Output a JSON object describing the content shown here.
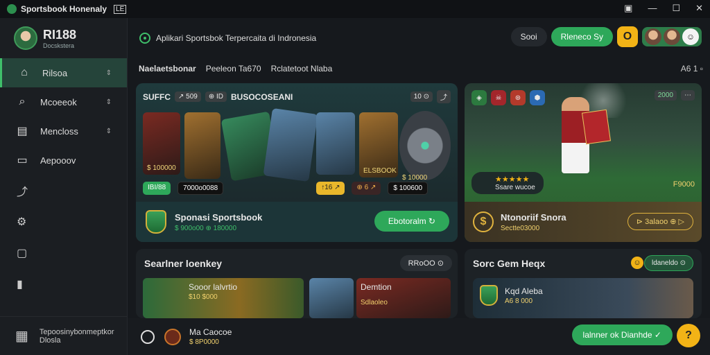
{
  "window": {
    "title": "Sportsbook Honenaly",
    "mark": "LE",
    "controls": [
      "▣",
      "—",
      "☐",
      "✕"
    ]
  },
  "brand": {
    "name": "RI188",
    "sub": "Docskstera"
  },
  "sidebar": {
    "items": [
      {
        "label": "Rilsoa",
        "icon": "home-icon",
        "glyph": "⌂",
        "chev": "⇕"
      },
      {
        "label": "Mcoeeok",
        "icon": "search-icon",
        "glyph": "⌕",
        "chev": "⇕"
      },
      {
        "label": "Mencloss",
        "icon": "calendar-icon",
        "glyph": "▤",
        "chev": "⇕"
      },
      {
        "label": "Aepooov",
        "icon": "document-icon",
        "glyph": "▭",
        "chev": ""
      }
    ],
    "icon_items": [
      {
        "icon": "share-icon",
        "glyph": "⤴"
      },
      {
        "icon": "gear-icon",
        "glyph": "⚙"
      },
      {
        "icon": "image-icon",
        "glyph": "▢"
      },
      {
        "icon": "bag-icon",
        "glyph": "▮"
      }
    ],
    "footer": {
      "line1": "Tepoosinybonmeptkor",
      "line2": "Dlosla",
      "glyph": "▦"
    }
  },
  "topbar": {
    "tagline": "Aplikari Sportsbok Terpercaita di Indronesia",
    "pill_dark": "Sooi",
    "pill_green": "Rleneco Sy",
    "coin": "O"
  },
  "tabs": {
    "items": [
      "Naelaetsbonar",
      "Peeleon Ta670",
      "Rclatetoot Nlaba"
    ],
    "right": "A6 1 ▫"
  },
  "main_card": {
    "header": "SUFFC",
    "tags": [
      "↗ 509",
      "⊕ ID"
    ],
    "heading": "BUSOCOSEANI",
    "header_right": [
      "10 ⊙",
      "⤴"
    ],
    "tile_labels": [
      "$ 100000",
      "ELSBOOK",
      "$ 10000"
    ],
    "chips": [
      "IBI/88",
      "7000o0088",
      "↑16 ↗",
      "⊕ 6 ↗",
      "$ 100600"
    ],
    "title": "Sponasi Sportsbook",
    "sub": "$ 900o00 ⊕ 180000",
    "button": "Ebotoralm ↻"
  },
  "stadium_card": {
    "badges": [
      "◈",
      "☠",
      "⊛",
      "⬢"
    ],
    "stat": [
      "2000",
      "⋯"
    ],
    "stars": "★★★★★",
    "rating_text": "Ssare wucoe",
    "price": "F9000",
    "title": "Ntonoriif Snora",
    "sub": "Sectte03000",
    "medal": "$",
    "button": "⊳ 3alaoo ⊕ ▷"
  },
  "promo_left": {
    "title": "Searlner loenkey",
    "pill": "RRoOO ⊙",
    "thumb1_title": "Sooor lalvrtio",
    "thumb1_sub": "$10 $000",
    "thumb2_title": "Demtion",
    "thumb2_sub": "Sdlaoleo"
  },
  "promo_right": {
    "title": "Sorc Gem Heqx",
    "smile": "☺",
    "pill": "ldaneldo ⊙",
    "mini_title": "Kqd Aleba",
    "mini_sub": "A6 8 000"
  },
  "bottombar": {
    "title": "Ma Caocoe",
    "sub": "$ 8P0000",
    "button": "lalnner ok Dianhde ✓",
    "help": "?"
  }
}
